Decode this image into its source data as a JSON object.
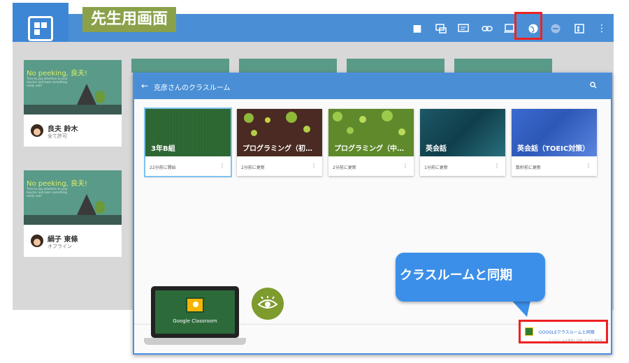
{
  "labels": {
    "teacher_screen": "先生用画面",
    "callout": "クラスルームと同期"
  },
  "students": [
    {
      "title": "No peeking, 良夫!",
      "desc": "Time to pay attention to your teacher and learn something really cool!",
      "name": "良夫 鈴木",
      "status": "全て許可"
    },
    {
      "title": "No peeking, 良夫!",
      "desc": "Time to pay attention to your teacher and learn something really cool!",
      "name": "絹子 東條",
      "status": "オフライン"
    }
  ],
  "dialog": {
    "title": "克彦さんのクラスルーム",
    "classes": [
      {
        "name": "3年B組",
        "meta": "22分前に開始",
        "color": "#2f6a35"
      },
      {
        "name": "プログラミング（初…",
        "meta": "2分前に更新",
        "color": "#4a2a22"
      },
      {
        "name": "プログラミング（中…",
        "meta": "2分前に更新",
        "color": "#5f8a2c"
      },
      {
        "name": "英会話",
        "meta": "1分前に更新",
        "color": "#1d5866"
      },
      {
        "name": "英会話（TOEIC対策）",
        "meta": "数秒前に更新",
        "color": "#2d58b7"
      }
    ],
    "sync_button": "GOOGLEクラスルームと同期",
    "sync_sub": "クラスルームを最後に同期したのは 数秒前"
  },
  "laptop": {
    "label": "Google Classroom"
  },
  "icons": [
    "stop-icon",
    "present-icon",
    "message-icon",
    "link-icon",
    "screen-icon",
    "web-icon",
    "block-icon",
    "dashboard-icon",
    "more-icon"
  ]
}
